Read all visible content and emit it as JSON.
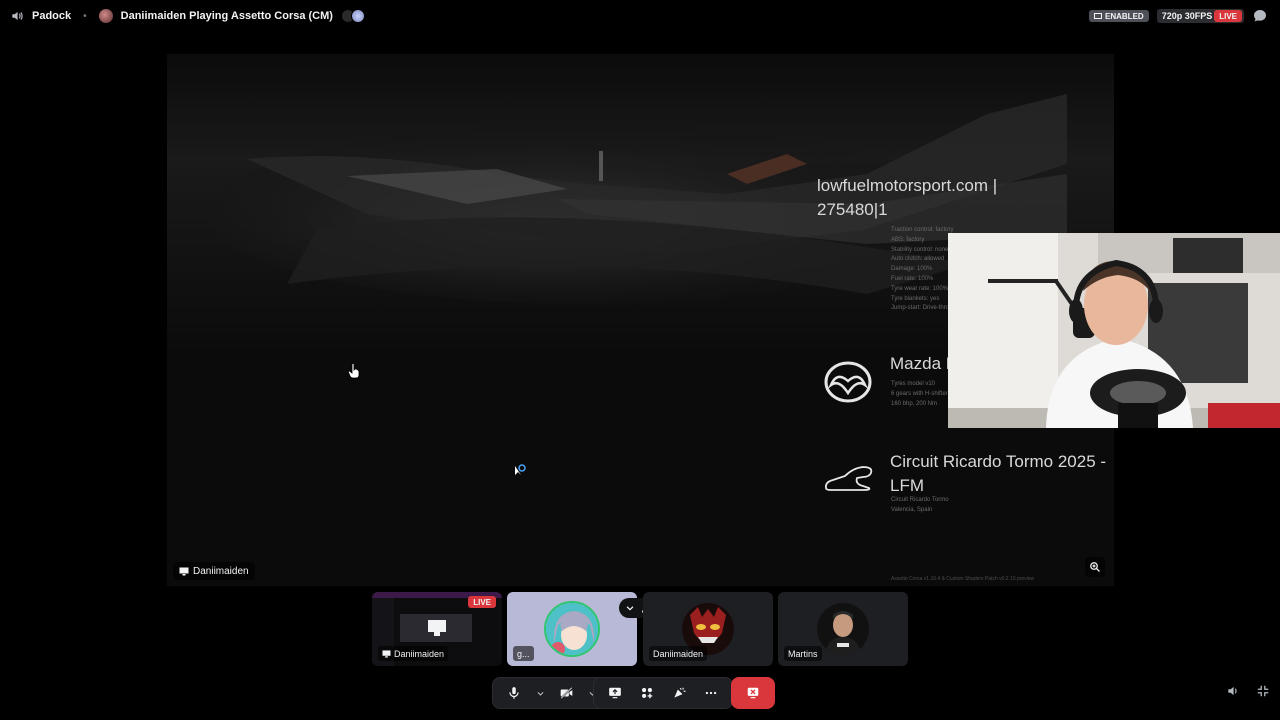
{
  "topbar": {
    "channel": "Padock",
    "separator": "•",
    "stream_title": "Daniimaiden Playing Assetto Corsa (CM)",
    "badge_enabled": "ENABLED",
    "quality": "720p 30FPS",
    "live": "LIVE"
  },
  "stage": {
    "streamer_label": "Daniimaiden",
    "game_ui": {
      "lfm_title_line1": "lowfuelmotorsport.com |",
      "lfm_title_line2": "275480|1",
      "lfm_details": [
        "Traction control: factory",
        "ABS: factory",
        "Stability control: none",
        "Auto clutch: allowed",
        "Damage: 100%",
        "Fuel rate: 100%",
        "Tyre wear rate: 100%",
        "Tyre blankets: yes",
        "Jump-start: Drive-through"
      ],
      "car_name": "Mazda M",
      "car_specs": [
        "Tyres model v10",
        "6 gears with H-shifter",
        "160 bhp, 200 Nm"
      ],
      "track_name": "Circuit Ricardo Tormo 2025 - LFM",
      "track_location": [
        "Circuit Ricardo Tormo",
        "Valencia, Spain"
      ],
      "version": "Assetto Corsa v1.16.4 & Custom Shaders Patch v0.2.10 preview"
    }
  },
  "participants": [
    {
      "name": "Daniimaiden",
      "live": "LIVE",
      "kind": "stream"
    },
    {
      "name": "g...",
      "kind": "avatar"
    },
    {
      "name": "Daniimaiden",
      "kind": "avatar"
    },
    {
      "name": "Martins",
      "kind": "avatar"
    }
  ],
  "controls": {
    "mic": "microphone-icon",
    "camera": "camera-off-icon",
    "share": "screen-share-icon",
    "activities": "activities-icon",
    "soundboard": "soundboard-icon",
    "more": "more-icon",
    "leave": "leave-call-icon",
    "volume": "speaker-icon",
    "exit_fullscreen": "exit-fullscreen-icon"
  },
  "colors": {
    "danger": "#da373c",
    "bar_bg": "#1e1f22",
    "badge_bg": "#4e5058"
  }
}
